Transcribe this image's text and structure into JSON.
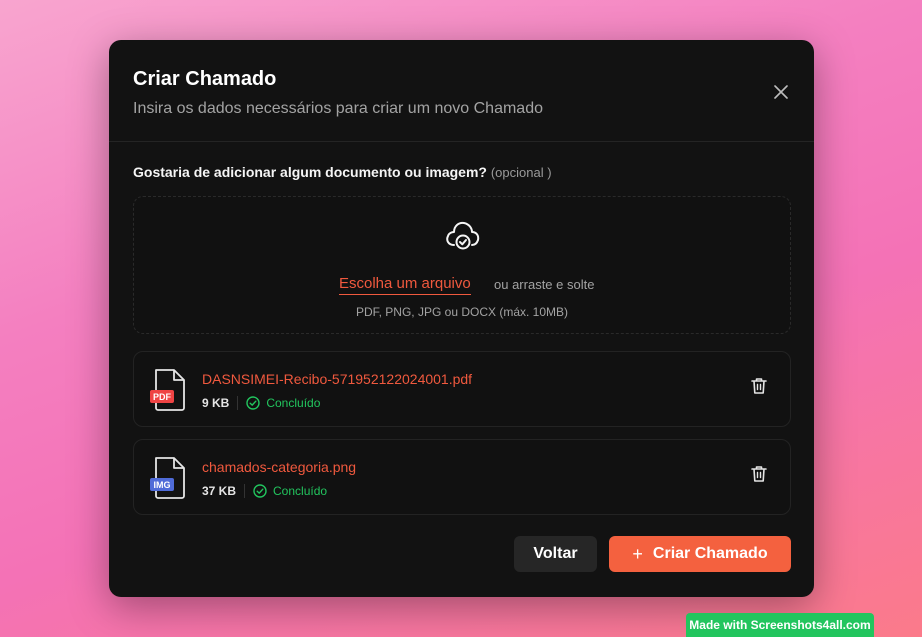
{
  "modal": {
    "title": "Criar Chamado",
    "subtitle": "Insira os dados necessários para criar um novo Chamado"
  },
  "upload": {
    "question": "Gostaria de adicionar algum documento ou imagem?",
    "optional": "(opcional )",
    "choose_label": "Escolha um arquivo",
    "drag_label": "ou arraste e solte",
    "formats": "PDF, PNG, JPG ou DOCX (máx. 10MB)"
  },
  "files": [
    {
      "name": "DASNSIMEI-Recibo-571952122024001.pdf",
      "size": "9 KB",
      "status": "Concluído",
      "badge": "PDF",
      "badge_color": "#ef4444"
    },
    {
      "name": "chamados-categoria.png",
      "size": "37 KB",
      "status": "Concluído",
      "badge": "IMG",
      "badge_color": "#4f6bd8"
    }
  ],
  "actions": {
    "back_label": "Voltar",
    "create_plus": "+",
    "create_label": "Criar Chamado"
  },
  "watermark": "Made with Screenshots4all.com",
  "colors": {
    "accent": "#f4613f",
    "success": "#22c55e",
    "modal_bg": "#121212"
  }
}
